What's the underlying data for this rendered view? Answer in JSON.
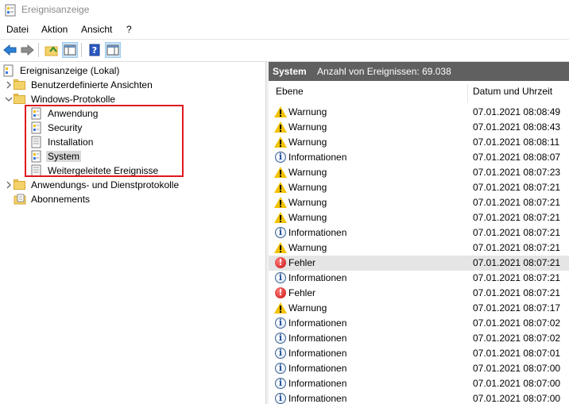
{
  "window": {
    "title": "Ereignisanzeige"
  },
  "menu": {
    "items": [
      "Datei",
      "Aktion",
      "Ansicht",
      "?"
    ]
  },
  "toolbar": {
    "buttons": [
      "back-arrow-icon",
      "forward-arrow-icon",
      "folder-up-icon",
      "show-hide-console-tree-icon",
      "help-icon",
      "show-hide-action-pane-icon"
    ]
  },
  "tree": {
    "root": "Ereignisanzeige (Lokal)",
    "custom_views": "Benutzerdefinierte Ansichten",
    "windows_logs": "Windows-Protokolle",
    "logs": [
      "Anwendung",
      "Security",
      "Installation",
      "System",
      "Weitergeleitete Ereignisse"
    ],
    "selected": "System",
    "app_service_logs": "Anwendungs- und Dienstprotokolle",
    "subscriptions": "Abonnements"
  },
  "panel": {
    "name": "System",
    "count_text": "Anzahl von Ereignissen: 69.038",
    "columns": [
      "Ebene",
      "Datum und Uhrzeit"
    ]
  },
  "events": [
    {
      "level": "Warnung",
      "type": "warning",
      "datetime": "07.01.2021 08:08:49"
    },
    {
      "level": "Warnung",
      "type": "warning",
      "datetime": "07.01.2021 08:08:43"
    },
    {
      "level": "Warnung",
      "type": "warning",
      "datetime": "07.01.2021 08:08:11"
    },
    {
      "level": "Informationen",
      "type": "info",
      "datetime": "07.01.2021 08:08:07"
    },
    {
      "level": "Warnung",
      "type": "warning",
      "datetime": "07.01.2021 08:07:23"
    },
    {
      "level": "Warnung",
      "type": "warning",
      "datetime": "07.01.2021 08:07:21"
    },
    {
      "level": "Warnung",
      "type": "warning",
      "datetime": "07.01.2021 08:07:21"
    },
    {
      "level": "Warnung",
      "type": "warning",
      "datetime": "07.01.2021 08:07:21"
    },
    {
      "level": "Informationen",
      "type": "info",
      "datetime": "07.01.2021 08:07:21"
    },
    {
      "level": "Warnung",
      "type": "warning",
      "datetime": "07.01.2021 08:07:21"
    },
    {
      "level": "Fehler",
      "type": "error",
      "datetime": "07.01.2021 08:07:21",
      "hovered": true
    },
    {
      "level": "Informationen",
      "type": "info",
      "datetime": "07.01.2021 08:07:21"
    },
    {
      "level": "Fehler",
      "type": "error",
      "datetime": "07.01.2021 08:07:21"
    },
    {
      "level": "Warnung",
      "type": "warning",
      "datetime": "07.01.2021 08:07:17"
    },
    {
      "level": "Informationen",
      "type": "info",
      "datetime": "07.01.2021 08:07:02"
    },
    {
      "level": "Informationen",
      "type": "info",
      "datetime": "07.01.2021 08:07:02"
    },
    {
      "level": "Informationen",
      "type": "info",
      "datetime": "07.01.2021 08:07:01"
    },
    {
      "level": "Informationen",
      "type": "info",
      "datetime": "07.01.2021 08:07:00"
    },
    {
      "level": "Informationen",
      "type": "info",
      "datetime": "07.01.2021 08:07:00"
    },
    {
      "level": "Informationen",
      "type": "info",
      "datetime": "07.01.2021 08:07:00"
    }
  ],
  "colors": {
    "panel_header": "#606060",
    "highlight_box": "#e0191f",
    "warning": "#f2c200",
    "error": "#c81010",
    "info": "#1f4f9a"
  }
}
